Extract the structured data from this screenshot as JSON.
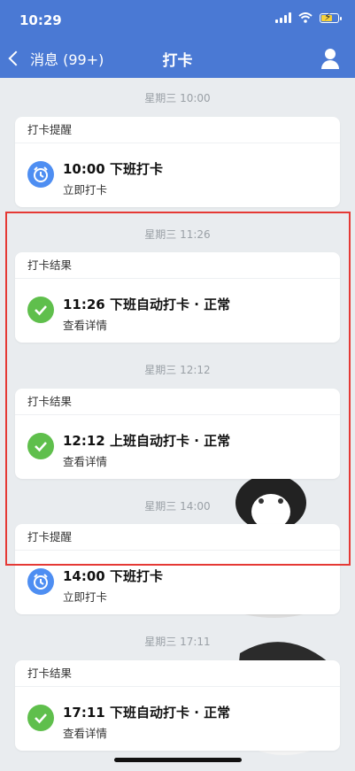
{
  "status": {
    "time": "10:29"
  },
  "nav": {
    "back_label": "消息 (99+)",
    "title": "打卡"
  },
  "timeline": [
    {
      "time": "星期三 10:00",
      "card_title": "打卡提醒",
      "main": "10:00 下班打卡",
      "sub": "立即打卡",
      "icon": "alarm-clock-icon"
    },
    {
      "time": "星期三 11:26",
      "card_title": "打卡结果",
      "main": "11:26 下班自动打卡 · 正常",
      "sub": "查看详情",
      "icon": "check-icon"
    },
    {
      "time": "星期三 12:12",
      "card_title": "打卡结果",
      "main": "12:12 上班自动打卡 · 正常",
      "sub": "查看详情",
      "icon": "check-icon"
    },
    {
      "time": "星期三 14:00",
      "card_title": "打卡提醒",
      "main": "14:00 下班打卡",
      "sub": "立即打卡",
      "icon": "alarm-clock-icon"
    },
    {
      "time": "星期三 17:11",
      "card_title": "打卡结果",
      "main": "17:11 下班自动打卡 · 正常",
      "sub": "查看详情",
      "icon": "check-icon"
    }
  ],
  "colors": {
    "nav_bg": "#4a79d4",
    "alarm": "#4e8ef2",
    "check": "#5fbf4c",
    "highlight": "#e53935"
  }
}
